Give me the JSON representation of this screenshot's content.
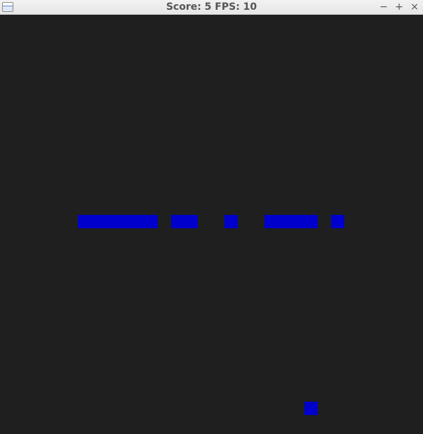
{
  "window": {
    "title": "Score: 5 FPS: 10",
    "controls": {
      "minimize": "−",
      "maximize": "+",
      "close": "×"
    }
  },
  "colors": {
    "background": "#1f1f1f",
    "block": "#0000cc"
  },
  "game": {
    "score": 5,
    "fps": 10
  }
}
